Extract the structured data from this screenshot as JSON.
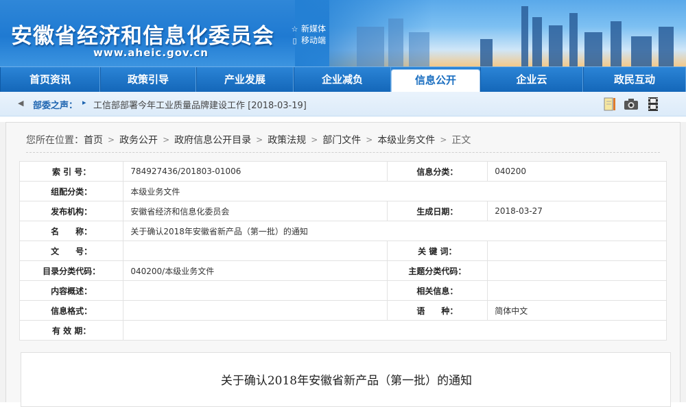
{
  "header": {
    "site_title": "安徽省经济和信息化委员会",
    "site_url": "www.aheic.gov.cn",
    "quick_links": [
      {
        "icon": "star-icon",
        "label": "新媒体"
      },
      {
        "icon": "mobile-icon",
        "label": "移动端"
      }
    ]
  },
  "nav": {
    "items": [
      {
        "label": "首页资讯"
      },
      {
        "label": "政策引导"
      },
      {
        "label": "产业发展"
      },
      {
        "label": "企业减负"
      },
      {
        "label": "信息公开"
      },
      {
        "label": "企业云"
      },
      {
        "label": "政民互动"
      }
    ],
    "active_index": 4
  },
  "notice": {
    "label": "部委之声：",
    "text": "工信部部署今年工业质量品牌建设工作 [2018-03-19]",
    "icons": [
      "notebook-icon",
      "camera-icon",
      "film-icon"
    ]
  },
  "breadcrumb": {
    "prefix": "您所在位置：",
    "items": [
      "首页",
      "政务公开",
      "政府信息公开目录",
      "政策法规",
      "部门文件",
      "本级业务文件"
    ],
    "current": "正文"
  },
  "meta": {
    "index_label": "索 引 号：",
    "index_value": "784927436/201803-01006",
    "info_category_label": "信息分类：",
    "info_category_value": "040200",
    "group_category_label": "组配分类：",
    "group_category_value": "本级业务文件",
    "publisher_label": "发布机构：",
    "publisher_value": "安徽省经济和信息化委员会",
    "date_label": "生成日期：",
    "date_value": "2018-03-27",
    "name_label": "名　　称：",
    "name_value": "关于确认2018年安徽省新产品（第一批）的通知",
    "doc_no_label": "文　　号：",
    "doc_no_value": "",
    "keywords_label": "关 键 词：",
    "keywords_value": "",
    "catalog_code_label": "目录分类代码：",
    "catalog_code_value": "040200/本级业务文件",
    "topic_code_label": "主题分类代码：",
    "topic_code_value": "",
    "summary_label": "内容概述：",
    "summary_value": "",
    "related_label": "相关信息：",
    "related_value": "",
    "format_label": "信息格式：",
    "format_value": "",
    "language_label": "语　　种：",
    "language_value": "简体中文",
    "validity_label": "有 效 期：",
    "validity_value": ""
  },
  "document": {
    "title": "关于确认2018年安徽省新产品（第一批）的通知"
  }
}
